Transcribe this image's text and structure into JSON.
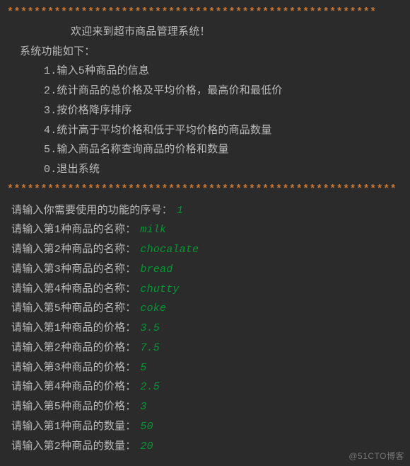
{
  "banner": {
    "stars_top": "*******************************************************",
    "title": "欢迎来到超市商品管理系统！",
    "subtitle": "系统功能如下：",
    "items": [
      "1.输入5种商品的信息",
      "2.统计商品的总价格及平均价格，最高价和最低价",
      "3.按价格降序排序",
      "4.统计高于平均价格和低于平均价格的商品数量",
      "5.输入商品名称查询商品的价格和数量",
      "0.退出系统"
    ],
    "stars_bottom": "**********************************************************"
  },
  "prompts": [
    {
      "label": "请输入你需要使用的功能的序号：",
      "value": "1"
    },
    {
      "label": "请输入第1种商品的名称：",
      "value": "milk"
    },
    {
      "label": "请输入第2种商品的名称：",
      "value": "chocalate"
    },
    {
      "label": "请输入第3种商品的名称：",
      "value": "bread"
    },
    {
      "label": "请输入第4种商品的名称：",
      "value": "chutty"
    },
    {
      "label": "请输入第5种商品的名称：",
      "value": "coke"
    },
    {
      "label": "请输入第1种商品的价格：",
      "value": "3.5"
    },
    {
      "label": "请输入第2种商品的价格：",
      "value": "7.5"
    },
    {
      "label": "请输入第3种商品的价格：",
      "value": "5"
    },
    {
      "label": "请输入第4种商品的价格：",
      "value": "2.5"
    },
    {
      "label": "请输入第5种商品的价格：",
      "value": "3"
    },
    {
      "label": "请输入第1种商品的数量：",
      "value": "50"
    },
    {
      "label": "请输入第2种商品的数量：",
      "value": "20"
    }
  ],
  "watermark": "@51CTO博客"
}
